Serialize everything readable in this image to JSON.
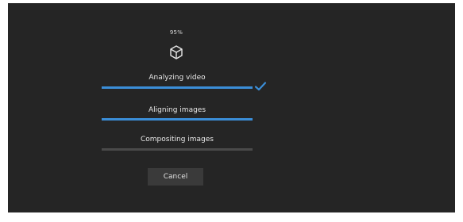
{
  "progress": {
    "percent_label": "95%"
  },
  "steps": [
    {
      "label": "Analyzing video",
      "progress": 1.0,
      "complete": true
    },
    {
      "label": "Aligning images",
      "progress": 1.0,
      "complete": false
    },
    {
      "label": "Compositing images",
      "progress": 0.0,
      "complete": false
    }
  ],
  "actions": {
    "cancel_label": "Cancel"
  },
  "colors": {
    "background": "#252525",
    "accent": "#3b8ed8",
    "track": "#4a4a4a",
    "button": "#3a3a3a"
  },
  "icons": {
    "header": "cube-icon",
    "done": "checkmark-icon"
  }
}
